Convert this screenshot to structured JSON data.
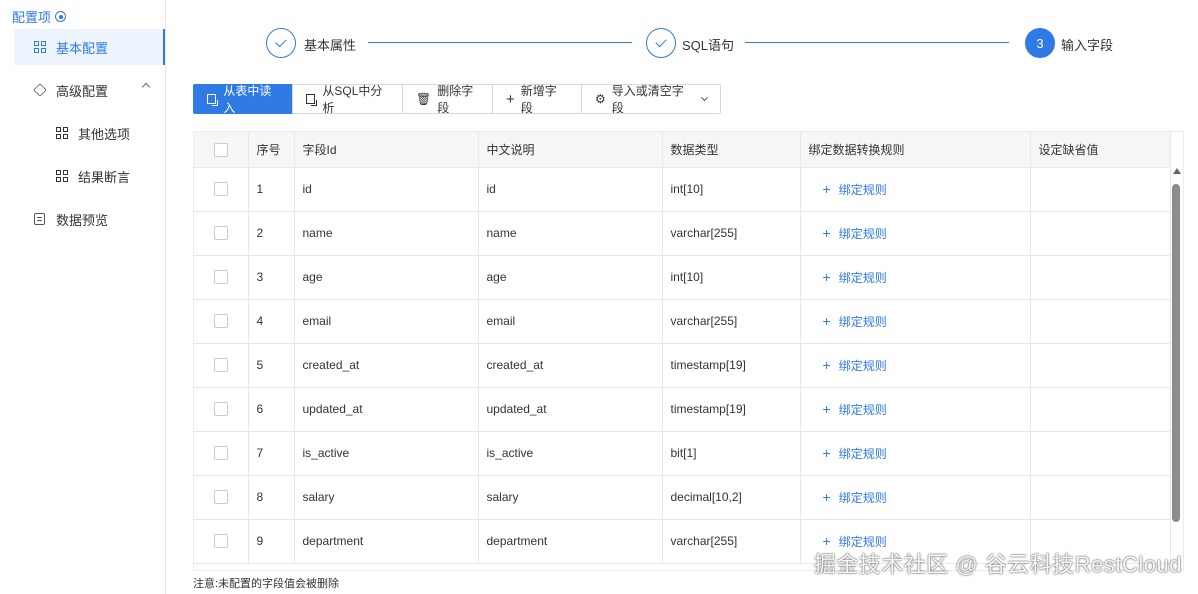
{
  "sidebar": {
    "title": "配置项",
    "items": [
      {
        "label": "基本配置"
      },
      {
        "label": "高级配置"
      },
      {
        "label": "其他选项"
      },
      {
        "label": "结果断言"
      },
      {
        "label": "数据预览"
      }
    ]
  },
  "steps": [
    {
      "label": "基本属性",
      "status": "done"
    },
    {
      "label": "SQL语句",
      "status": "done"
    },
    {
      "label": "输入字段",
      "status": "current",
      "number": "3"
    }
  ],
  "toolbar": {
    "read_from_table": "从表中读入",
    "parse_from_sql": "从SQL中分析",
    "delete_field": "删除字段",
    "add_field": "新增字段",
    "import_or_clear": "导入或清空字段"
  },
  "table": {
    "headers": [
      "序号",
      "字段Id",
      "中文说明",
      "数据类型",
      "绑定数据转换规则",
      "设定缺省值"
    ],
    "bind_label": "绑定规则",
    "rows": [
      {
        "no": "1",
        "id": "id",
        "desc": "id",
        "type": "int[10]"
      },
      {
        "no": "2",
        "id": "name",
        "desc": "name",
        "type": "varchar[255]"
      },
      {
        "no": "3",
        "id": "age",
        "desc": "age",
        "type": "int[10]"
      },
      {
        "no": "4",
        "id": "email",
        "desc": "email",
        "type": "varchar[255]"
      },
      {
        "no": "5",
        "id": "created_at",
        "desc": "created_at",
        "type": "timestamp[19]"
      },
      {
        "no": "6",
        "id": "updated_at",
        "desc": "updated_at",
        "type": "timestamp[19]"
      },
      {
        "no": "7",
        "id": "is_active",
        "desc": "is_active",
        "type": "bit[1]"
      },
      {
        "no": "8",
        "id": "salary",
        "desc": "salary",
        "type": "decimal[10,2]"
      },
      {
        "no": "9",
        "id": "department",
        "desc": "department",
        "type": "varchar[255]"
      }
    ]
  },
  "note": "注意:未配置的字段值会被删除",
  "watermark": "掘金技术社区 @ 谷云科技RestCloud",
  "colors": {
    "accent": "#2f7ae5"
  }
}
